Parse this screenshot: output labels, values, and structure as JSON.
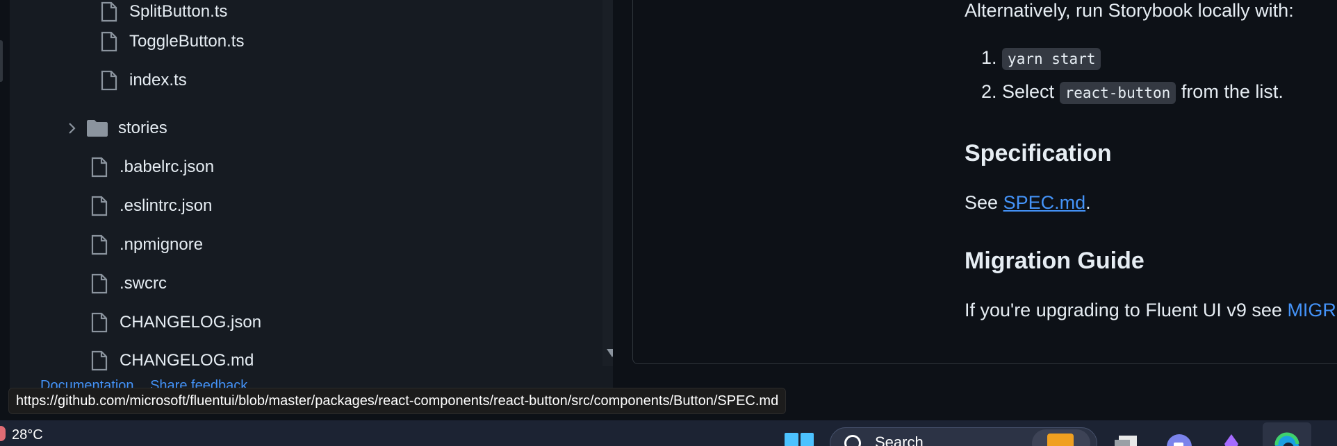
{
  "file_tree": {
    "items": [
      {
        "label": "SplitButton.ts",
        "type": "file"
      },
      {
        "label": "ToggleButton.ts",
        "type": "file"
      },
      {
        "label": "index.ts",
        "type": "file"
      },
      {
        "label": "stories",
        "type": "folder"
      },
      {
        "label": ".babelrc.json",
        "type": "file"
      },
      {
        "label": ".eslintrc.json",
        "type": "file"
      },
      {
        "label": ".npmignore",
        "type": "file"
      },
      {
        "label": ".swcrc",
        "type": "file"
      },
      {
        "label": "CHANGELOG.json",
        "type": "file"
      },
      {
        "label": "CHANGELOG.md",
        "type": "file"
      }
    ]
  },
  "sidebar_footer": {
    "documentation": "Documentation",
    "share_feedback": "Share feedback"
  },
  "readme": {
    "intro": "Alternatively, run Storybook locally with:",
    "step1_prefix": "1.",
    "step1_code": "yarn start",
    "step2_prefix": "2. Select",
    "step2_code": "react-button",
    "step2_suffix": "from the list.",
    "spec_heading": "Specification",
    "spec_prefix": "See",
    "spec_link": "SPEC.md",
    "spec_suffix": ".",
    "migration_heading": "Migration Guide",
    "migration_text": "If you're upgrading to Fluent UI v9 see",
    "migration_link": "MIGR"
  },
  "status_url": "https://github.com/microsoft/fluentui/blob/master/packages/react-components/react-button/src/components/Button/SPEC.md",
  "taskbar": {
    "weather": "28°C",
    "search": "Search"
  },
  "colors": {
    "link": "#4493f8",
    "background": "#0d1117",
    "sidebar": "#161b22"
  }
}
